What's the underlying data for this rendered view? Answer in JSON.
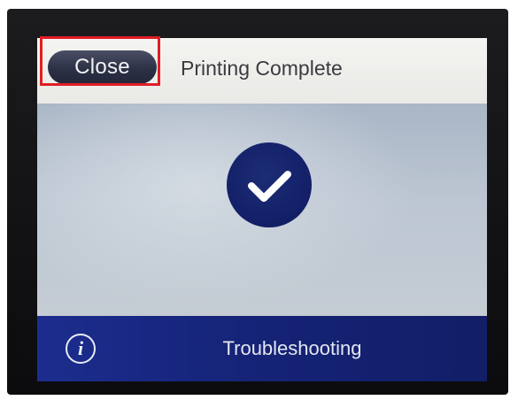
{
  "header": {
    "close_label": "Close",
    "title": "Printing Complete"
  },
  "status": {
    "icon": "checkmark-icon"
  },
  "footer": {
    "info_icon": "i",
    "troubleshooting_label": "Troubleshooting"
  },
  "colors": {
    "highlight": "#e01e26",
    "check_circle": "#14216a",
    "footer": "#16247a",
    "close_button": "#2d3146"
  }
}
